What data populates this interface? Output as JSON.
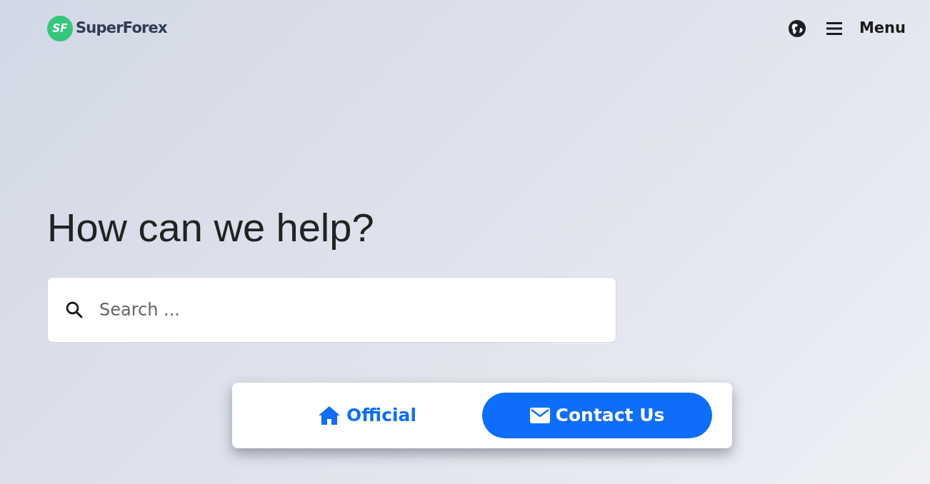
{
  "header": {
    "logo_mark": "SF",
    "logo_text": "SuperForex",
    "menu_label": "Menu"
  },
  "hero": {
    "title": "How can we help?",
    "search": {
      "placeholder": "Search ..."
    }
  },
  "actions": [
    {
      "label": "Official",
      "kind": "link"
    },
    {
      "label": "Contact Us",
      "kind": "primary"
    }
  ]
}
